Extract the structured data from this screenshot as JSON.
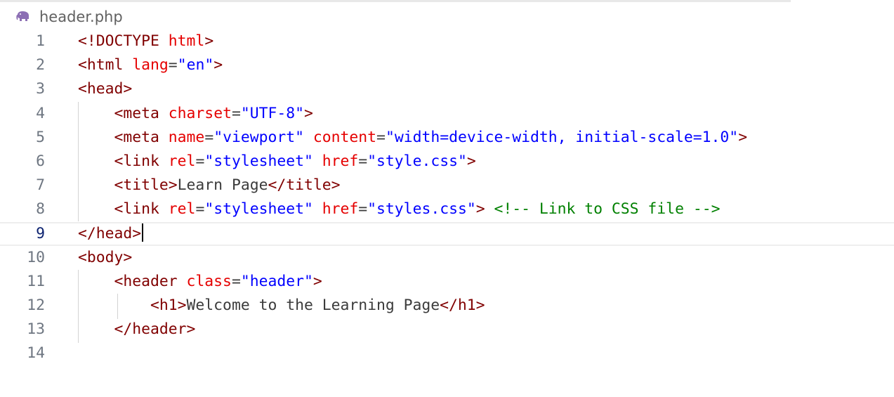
{
  "tab": {
    "file_name": "header.php",
    "icon": "php-elephant-icon"
  },
  "editor": {
    "current_line": 9,
    "lines": [
      {
        "number": "1",
        "tokens": [
          {
            "t": "tag",
            "v": "<!DOCTYPE "
          },
          {
            "t": "attr",
            "v": "html"
          },
          {
            "t": "tag",
            "v": ">"
          }
        ]
      },
      {
        "number": "2",
        "tokens": [
          {
            "t": "tag",
            "v": "<html "
          },
          {
            "t": "attr",
            "v": "lang"
          },
          {
            "t": "eq",
            "v": "="
          },
          {
            "t": "str",
            "v": "\"en\""
          },
          {
            "t": "tag",
            "v": ">"
          }
        ]
      },
      {
        "number": "3",
        "tokens": [
          {
            "t": "tag",
            "v": "<head>"
          }
        ]
      },
      {
        "number": "4",
        "tokens": [
          {
            "t": "text",
            "v": "    "
          },
          {
            "t": "tag",
            "v": "<meta "
          },
          {
            "t": "attr",
            "v": "charset"
          },
          {
            "t": "eq",
            "v": "="
          },
          {
            "t": "str",
            "v": "\"UTF-8\""
          },
          {
            "t": "tag",
            "v": ">"
          }
        ]
      },
      {
        "number": "5",
        "tokens": [
          {
            "t": "text",
            "v": "    "
          },
          {
            "t": "tag",
            "v": "<meta "
          },
          {
            "t": "attr",
            "v": "name"
          },
          {
            "t": "eq",
            "v": "="
          },
          {
            "t": "str",
            "v": "\"viewport\""
          },
          {
            "t": "text",
            "v": " "
          },
          {
            "t": "attr",
            "v": "content"
          },
          {
            "t": "eq",
            "v": "="
          },
          {
            "t": "str",
            "v": "\"width=device-width, initial-scale=1.0\""
          },
          {
            "t": "tag",
            "v": ">"
          }
        ]
      },
      {
        "number": "6",
        "tokens": [
          {
            "t": "text",
            "v": "    "
          },
          {
            "t": "tag",
            "v": "<link "
          },
          {
            "t": "attr",
            "v": "rel"
          },
          {
            "t": "eq",
            "v": "="
          },
          {
            "t": "str",
            "v": "\"stylesheet\""
          },
          {
            "t": "text",
            "v": " "
          },
          {
            "t": "attr",
            "v": "href"
          },
          {
            "t": "eq",
            "v": "="
          },
          {
            "t": "str",
            "v": "\"style.css\""
          },
          {
            "t": "tag",
            "v": ">"
          }
        ]
      },
      {
        "number": "7",
        "tokens": [
          {
            "t": "text",
            "v": "    "
          },
          {
            "t": "tag",
            "v": "<title>"
          },
          {
            "t": "text",
            "v": "Learn Page"
          },
          {
            "t": "tag",
            "v": "</title>"
          }
        ]
      },
      {
        "number": "8",
        "tokens": [
          {
            "t": "text",
            "v": "    "
          },
          {
            "t": "tag",
            "v": "<link "
          },
          {
            "t": "attr",
            "v": "rel"
          },
          {
            "t": "eq",
            "v": "="
          },
          {
            "t": "str",
            "v": "\"stylesheet\""
          },
          {
            "t": "text",
            "v": " "
          },
          {
            "t": "attr",
            "v": "href"
          },
          {
            "t": "eq",
            "v": "="
          },
          {
            "t": "str",
            "v": "\"styles.css\""
          },
          {
            "t": "tag",
            "v": ">"
          },
          {
            "t": "text",
            "v": " "
          },
          {
            "t": "comment",
            "v": "<!-- Link to CSS file -->"
          }
        ]
      },
      {
        "number": "9",
        "tokens": [
          {
            "t": "tag",
            "v": "</head>"
          }
        ]
      },
      {
        "number": "10",
        "tokens": [
          {
            "t": "tag",
            "v": "<body>"
          }
        ]
      },
      {
        "number": "11",
        "tokens": [
          {
            "t": "text",
            "v": "    "
          },
          {
            "t": "tag",
            "v": "<header "
          },
          {
            "t": "attr",
            "v": "class"
          },
          {
            "t": "eq",
            "v": "="
          },
          {
            "t": "str",
            "v": "\"header\""
          },
          {
            "t": "tag",
            "v": ">"
          }
        ]
      },
      {
        "number": "12",
        "tokens": [
          {
            "t": "text",
            "v": "        "
          },
          {
            "t": "tag",
            "v": "<h1>"
          },
          {
            "t": "text",
            "v": "Welcome to the Learning Page"
          },
          {
            "t": "tag",
            "v": "</h1>"
          }
        ]
      },
      {
        "number": "13",
        "tokens": [
          {
            "t": "text",
            "v": "    "
          },
          {
            "t": "tag",
            "v": "</header>"
          }
        ]
      },
      {
        "number": "14",
        "tokens": []
      }
    ]
  },
  "colors": {
    "tag": "#800000",
    "attribute": "#e50000",
    "string": "#0000ff",
    "text": "#3b3b3b",
    "comment": "#008000",
    "line_number": "#6e7681",
    "current_line_number": "#0b216f",
    "php_icon": "#8c6fb4"
  }
}
